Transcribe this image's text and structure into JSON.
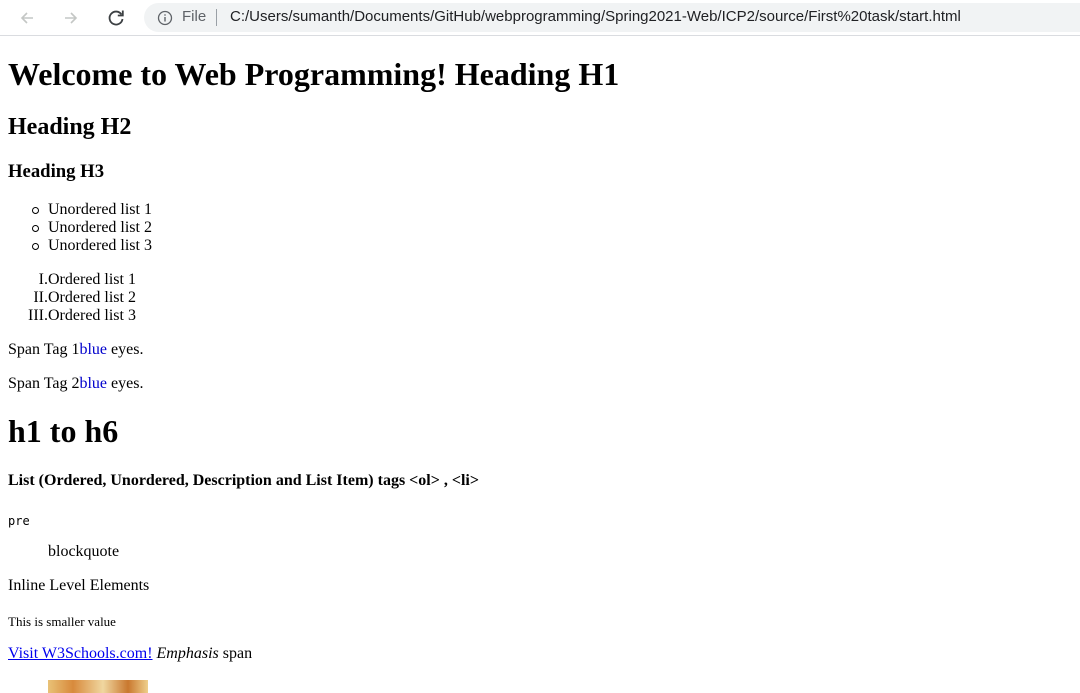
{
  "browser": {
    "file_label": "File",
    "url": "C:/Users/sumanth/Documents/GitHub/webprogramming/Spring2021-Web/ICP2/source/First%20task/start.html"
  },
  "page": {
    "h1": "Welcome to Web Programming! Heading H1",
    "h2": "Heading H2",
    "h3": "Heading H3",
    "unordered_list": [
      "Unordered list 1",
      "Unordered list 2",
      "Unordered list 3"
    ],
    "ordered_list": [
      {
        "num": "I.",
        "label": "Ordered list 1"
      },
      {
        "num": "II.",
        "label": "Ordered list 2"
      },
      {
        "num": "III.",
        "label": "Ordered list 3"
      }
    ],
    "span1": {
      "prefix": "Span Tag 1",
      "blue": "blue",
      "suffix": " eyes."
    },
    "span2": {
      "prefix": "Span Tag 2",
      "blue": "blue",
      "suffix": " eyes."
    },
    "h1_second": "h1 to h6",
    "h4": "List (Ordered, Unordered, Description and List Item) tags <ol> , <li>",
    "pre": "pre",
    "blockquote": "blockquote",
    "inline": "Inline Level Elements",
    "small": "This is smaller value",
    "link": "Visit W3Schools.com!",
    "emphasis": "Emphasis",
    "span_word": " span"
  }
}
